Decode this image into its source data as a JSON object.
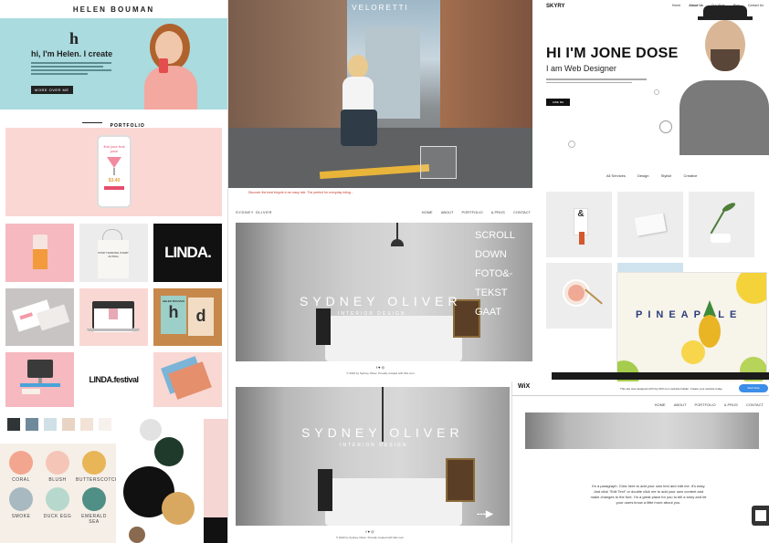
{
  "helen": {
    "name": "HELEN BOUMAN",
    "logo_letter": "h",
    "headline": "hi, I'm Helen. I create",
    "button": "MORE OVER ME",
    "portfolio": "PORTFOLIO",
    "drink_title": "find your fruit juice",
    "price": "$3.40",
    "tile_linda": "LINDA.",
    "tile_linda_festival": "LINDA.festival",
    "tote_text": "STOP THINKING START ACTING",
    "book_text": "HELEN BOUMAN",
    "swatch_colors": [
      "#2f3437",
      "#6e8a9a",
      "#cfe0e6",
      "#e9d3c4",
      "#f3e3d6",
      "#f7f1ee"
    ],
    "palette": [
      {
        "name": "CORAL",
        "color": "#f3a68f"
      },
      {
        "name": "BLUSH",
        "color": "#f5c6b8"
      },
      {
        "name": "BUTTERSCOTCH",
        "color": "#e8b657"
      },
      {
        "name": "SMOKE",
        "color": "#a9b9c1"
      },
      {
        "name": "DUCK EGG",
        "color": "#b7d8cd"
      },
      {
        "name": "EMERALD SEA",
        "color": "#4f8f85"
      }
    ]
  },
  "veloretti": {
    "brand": "VELORETTI",
    "caption": "Discover the best bicycle in an easy ride. The perfect for everyday riding..."
  },
  "skyry": {
    "brand": "SKYRY",
    "nav": [
      "Home",
      "About Us",
      "Our Work",
      "Blog",
      "Contact Us"
    ],
    "headline": "HI I'M JONE DOSE",
    "subtitle": "I am Web Designer",
    "button": "HIRE ME",
    "tabs": [
      "All Services",
      "Design",
      "Stylish",
      "Creative"
    ],
    "pineapple_word": "PINEAPPLE"
  },
  "sydney_top": {
    "logo": "SYDNEY OLIVER",
    "nav": [
      "HOME",
      "ABOUT",
      "PORTFOLIO",
      "& PRIJS",
      "CONTACT"
    ],
    "title": "SYDNEY OLIVER",
    "subtitle": "INTERIOR DESIGN",
    "scroll_lines": [
      "SCROLL",
      "DOWN",
      "FOTO&-",
      "TEKST",
      "GAAT"
    ],
    "footer_icons": "f ♥ ◎",
    "footer": "© 2023 by Sydney Oliver. Proudly created with Wix.com"
  },
  "sydney_bottom": {
    "title": "SYDNEY OLIVER",
    "subtitle": "INTERIOR DESIGN",
    "footer_icons": "f ♥ ◎",
    "footer": "© 2023 by Sydney Oliver. Proudly created with Wix.com",
    "arrow": "---▶"
  },
  "wix": {
    "logo": "WiX",
    "nav": [
      "HOME",
      "ABOUT",
      "PORTFOLIO",
      "& PRIJS",
      "CONTACT"
    ],
    "banner": "This site was designed with the WiX.com website builder. Create your website today.",
    "banner_button": "Start Now",
    "paragraph": "I'm a paragraph. Click here to add your own text and edit me. It's easy. Just click \"Edit Text\" or double click me to add your own content and make changes to the font. I'm a great place for you to tell a story and let your users know a little more about you."
  }
}
